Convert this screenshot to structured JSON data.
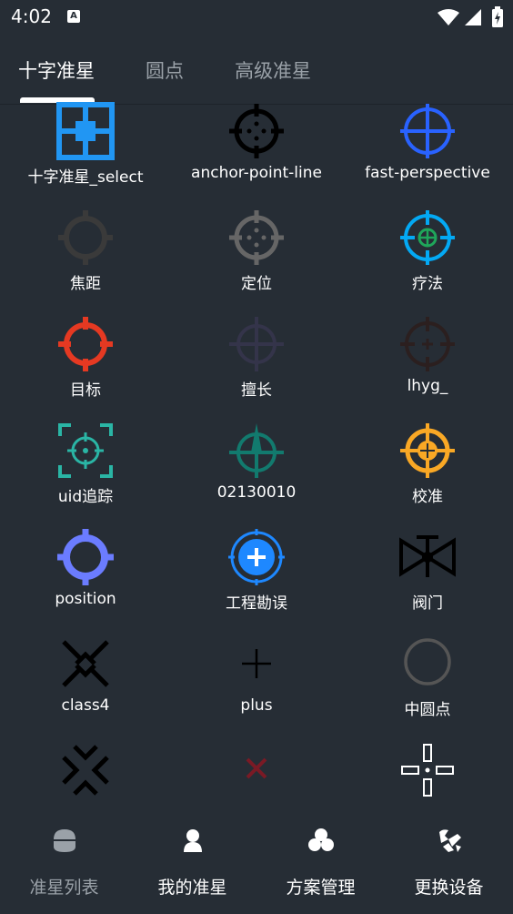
{
  "status_bar": {
    "time": "4:02",
    "notification_badge": "A"
  },
  "tabs": [
    {
      "label": "十字准星",
      "active": true
    },
    {
      "label": "圆点",
      "active": false
    },
    {
      "label": "高级准星",
      "active": false
    }
  ],
  "crosshairs": [
    {
      "label": "十字准星_select",
      "icon": "grid-square-crosshair-icon",
      "color": "#2196f3"
    },
    {
      "label": "anchor-point-line",
      "icon": "dotted-ring-crosshair-icon",
      "color": "#000000"
    },
    {
      "label": "fast-perspective",
      "icon": "ring-plus-crosshair-icon",
      "color": "#2962ff"
    },
    {
      "label": "焦距",
      "icon": "ring-crosshair-icon",
      "color": "#3a3a3a"
    },
    {
      "label": "定位",
      "icon": "dotted-ring-crosshair-icon",
      "color": "#666666"
    },
    {
      "label": "疗法",
      "icon": "double-ring-crosshair-icon",
      "color": "#03a9f4"
    },
    {
      "label": "目标",
      "icon": "ring-crosshair-icon",
      "color": "#e53922"
    },
    {
      "label": "擅长",
      "icon": "ring-plus-crosshair-icon",
      "color": "#34344a"
    },
    {
      "label": "lhyg_",
      "icon": "ring-plus-crosshair-icon",
      "color": "#2b1f1f"
    },
    {
      "label": "uid追踪",
      "icon": "bracket-dotted-ring-icon",
      "color": "#2ab5a5"
    },
    {
      "label": "02130010",
      "icon": "arrow-ring-crosshair-icon",
      "color": "#127a6e"
    },
    {
      "label": "校准",
      "icon": "target-crosshair-icon",
      "color": "#f9a825"
    },
    {
      "label": "position",
      "icon": "thick-ring-crosshair-icon",
      "color": "#6b7cff"
    },
    {
      "label": "工程勘误",
      "icon": "filled-plus-circle-icon",
      "color": "#1e88ff"
    },
    {
      "label": "阀门",
      "icon": "valve-icon",
      "color": "#000000"
    },
    {
      "label": "class4",
      "icon": "x-chevron-icon",
      "color": "#000000"
    },
    {
      "label": "plus",
      "icon": "plus-icon",
      "color": "#000000"
    },
    {
      "label": "中圆点",
      "icon": "circle-icon",
      "color": "#555555"
    },
    {
      "label": "",
      "icon": "x-chevron-icon",
      "color": "#000000"
    },
    {
      "label": "",
      "icon": "x-icon",
      "color": "#7a1a25"
    },
    {
      "label": "",
      "icon": "open-crosshair-icon",
      "color": "#ffffff"
    }
  ],
  "bottom_nav": [
    {
      "label": "准星列表",
      "icon": "crosshair-list-icon",
      "active": true
    },
    {
      "label": "我的准星",
      "icon": "person-icon",
      "active": false
    },
    {
      "label": "方案管理",
      "icon": "scheme-icon",
      "active": false
    },
    {
      "label": "更换设备",
      "icon": "device-switch-icon",
      "active": false
    }
  ]
}
